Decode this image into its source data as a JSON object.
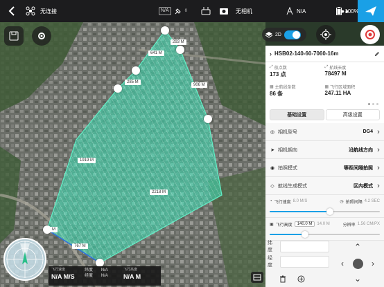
{
  "topbar": {
    "connection": "无连接",
    "signal_badge": "N/A",
    "gps_count": "0",
    "camera_label": "无相机",
    "rtk_value": "N/A",
    "battery": "100%"
  },
  "map": {
    "distances": [
      "293 M",
      "641 M",
      "285 M",
      "906 M",
      "1919 M",
      "2218 M",
      "M",
      "767 M"
    ],
    "toggle_label": "2D"
  },
  "telemetry": {
    "speed_label": "飞行速度",
    "speed_value": "N/A M/S",
    "lat_label": "纬度",
    "lat_value": "N/A",
    "lng_label": "经度",
    "lng_value": "N/A",
    "alt_label": "飞行高度",
    "alt_value": "N/A M"
  },
  "panel": {
    "mission_name": "HSB02-140-60-7060-16m",
    "stats": [
      {
        "label": "航点数",
        "value": "173 点"
      },
      {
        "label": "航线长度",
        "value": "78497 M"
      },
      {
        "label": "主航线条数",
        "value": "86 条"
      },
      {
        "label": "飞行区域面积",
        "value": "247.11 HA"
      }
    ],
    "tabs": [
      "基础设置",
      "高级设置"
    ],
    "rows": [
      {
        "label": "相机型号",
        "value": "DG4"
      },
      {
        "label": "相机朝向",
        "value": "沿航线方向"
      },
      {
        "label": "拍照模式",
        "value": "等距间隔拍照"
      },
      {
        "label": "航线生成模式",
        "value": "区内模式"
      }
    ],
    "speed": {
      "label": "飞行速度",
      "value": "8.0 M/S",
      "interval_label": "拍照间隔",
      "interval_value": "4.2 SEC",
      "fraction": 0.55
    },
    "altitude": {
      "label": "飞行高度",
      "value": "140.0 M",
      "gsd_value": "14.0 M",
      "res_label": "分辨率",
      "res_value": "1.56 CM/PX",
      "fraction": 0.32
    },
    "lat_label": "纬度",
    "lng_label": "经度"
  }
}
